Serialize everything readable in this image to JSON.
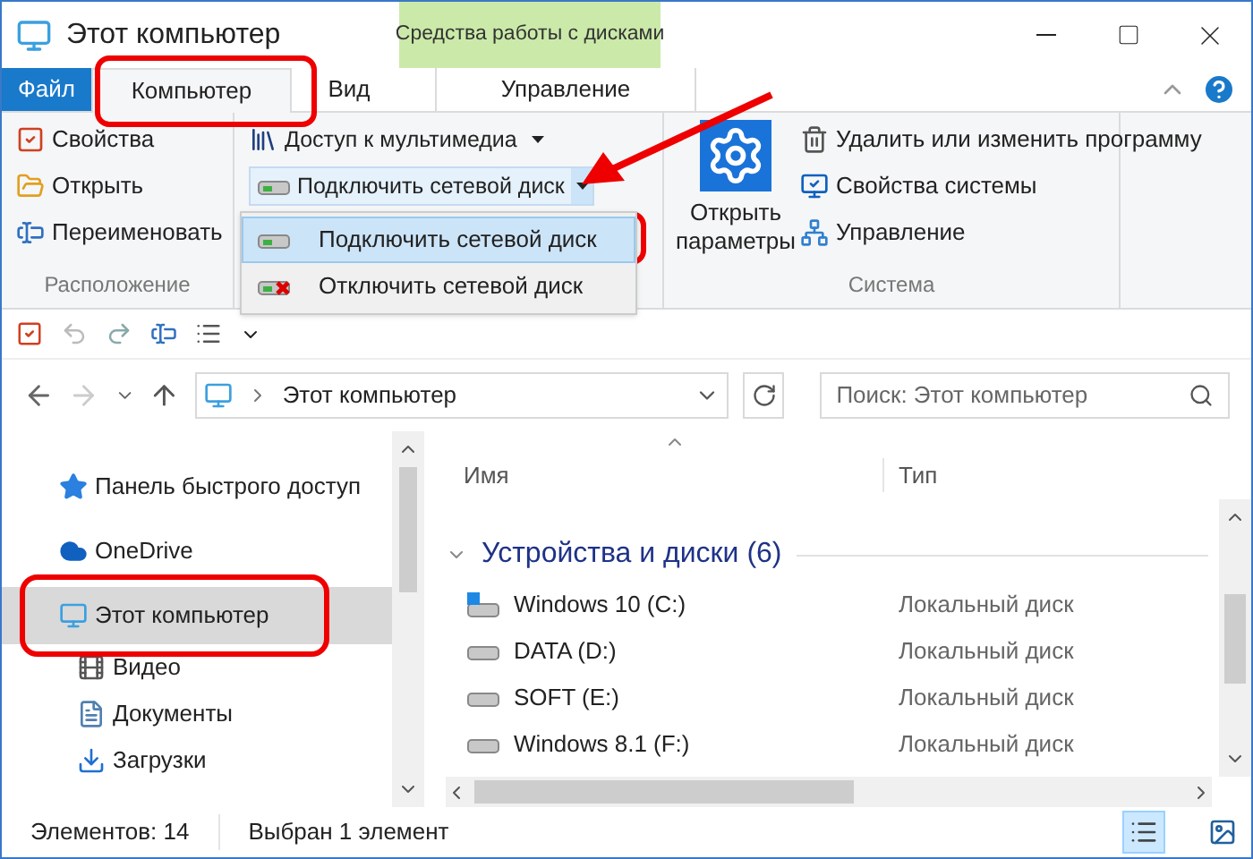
{
  "window": {
    "title": "Этот компьютер",
    "context_group": "Средства работы с дисками"
  },
  "tabs": [
    {
      "label": "Файл",
      "kind": "file",
      "selected": false
    },
    {
      "label": "Компьютер",
      "kind": "tab",
      "selected": true
    },
    {
      "label": "Вид",
      "kind": "tab",
      "selected": false
    },
    {
      "label": "Управление",
      "kind": "context",
      "selected": false
    }
  ],
  "ribbon": {
    "location": {
      "label": "Расположение",
      "items": [
        {
          "label": "Свойства",
          "kind": "properties"
        },
        {
          "label": "Открыть",
          "kind": "open"
        },
        {
          "label": "Переименовать",
          "kind": "rename"
        }
      ]
    },
    "network": {
      "items": [
        {
          "label": "Доступ к мультимедиа",
          "kind": "media"
        },
        {
          "label": "Подключить сетевой диск",
          "kind": "split"
        }
      ]
    },
    "menu": [
      {
        "label": "Подключить сетевой диск",
        "kind": "map",
        "selected": true
      },
      {
        "label": "Отключить сетевой диск",
        "kind": "unmap",
        "selected": false
      }
    ],
    "system": {
      "label": "Система",
      "big_button": "Открыть параметры",
      "items": [
        {
          "label": "Удалить или изменить программу",
          "kind": "uninstall"
        },
        {
          "label": "Свойства системы",
          "kind": "sysprops"
        },
        {
          "label": "Управление",
          "kind": "manage"
        }
      ]
    }
  },
  "address": {
    "path": "Этот компьютер",
    "search_placeholder": "Поиск: Этот компьютер"
  },
  "nav": [
    {
      "label": "Панель быстрого доступ",
      "kind": "star",
      "selected": false
    },
    {
      "label": "OneDrive",
      "kind": "cloud",
      "selected": false
    },
    {
      "label": "Этот компьютер",
      "kind": "pc",
      "selected": true,
      "children": [
        {
          "label": "Видео",
          "kind": "video",
          "selected": false
        },
        {
          "label": "Документы",
          "kind": "docs",
          "selected": false
        },
        {
          "label": "Загрузки",
          "kind": "downloads",
          "selected": false
        }
      ]
    }
  ],
  "table": {
    "columns": [
      "Имя",
      "Тип"
    ],
    "group": {
      "label": "Устройства и диски (6)",
      "expanded": true
    },
    "rows": [
      {
        "name": "Windows 10 (C:)",
        "type": "Локальный диск",
        "kind": "system"
      },
      {
        "name": "DATA (D:)",
        "type": "Локальный диск",
        "kind": "drive"
      },
      {
        "name": "SOFT (E:)",
        "type": "Локальный диск",
        "kind": "drive"
      },
      {
        "name": "Windows 8.1 (F:)",
        "type": "Локальный диск",
        "kind": "drive"
      }
    ]
  },
  "status_bar": {
    "items": [
      "Элементов: 14",
      "Выбран 1 элемент"
    ],
    "views": [
      {
        "kind": "details",
        "selected": true
      },
      {
        "kind": "tiles",
        "selected": false
      }
    ]
  }
}
